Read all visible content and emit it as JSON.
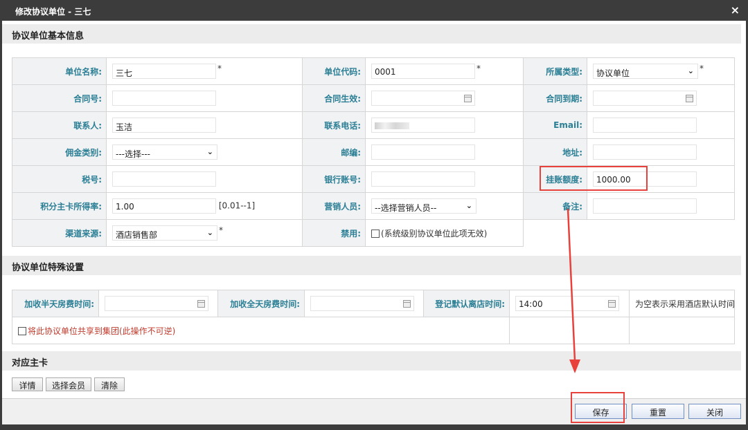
{
  "window": {
    "title": "修改协议单位 - 三七",
    "close_glyph": "×"
  },
  "sections": {
    "basic": "协议单位基本信息",
    "special": "协议单位特殊设置",
    "card": "对应主卡"
  },
  "basic": {
    "unit_name": {
      "label": "单位名称:",
      "value": "三七"
    },
    "unit_code": {
      "label": "单位代码:",
      "value": "0001"
    },
    "type": {
      "label": "所属类型:",
      "value": "协议单位"
    },
    "contract_no": {
      "label": "合同号:",
      "value": ""
    },
    "contract_start": {
      "label": "合同生效:",
      "value": ""
    },
    "contract_end": {
      "label": "合同到期:",
      "value": ""
    },
    "contact": {
      "label": "联系人:",
      "value": "玉洁"
    },
    "phone": {
      "label": "联系电话:",
      "value": ""
    },
    "email": {
      "label": "Email:",
      "value": ""
    },
    "commission": {
      "label": "佣金类别:",
      "value": "---选择---"
    },
    "postcode": {
      "label": "邮编:",
      "value": ""
    },
    "address": {
      "label": "地址:",
      "value": ""
    },
    "tax_no": {
      "label": "税号:",
      "value": ""
    },
    "bank_account": {
      "label": "银行账号:",
      "value": ""
    },
    "credit_limit": {
      "label": "挂账额度:",
      "value": "1000.00"
    },
    "points_rate": {
      "label": "积分主卡所得率:",
      "value": "1.00",
      "hint": "[0.01--1]"
    },
    "sales": {
      "label": "营销人员:",
      "value": "--选择营销人员--"
    },
    "remark": {
      "label": "备注:",
      "value": ""
    },
    "channel": {
      "label": "渠道来源:",
      "value": "酒店销售部"
    },
    "disabled": {
      "label": "禁用:",
      "text": "(系统级别协议单位此项无效)"
    },
    "required_mark": "*"
  },
  "special": {
    "half_day": {
      "label": "加收半天房费时间:",
      "value": ""
    },
    "full_day": {
      "label": "加收全天房费时间:",
      "value": ""
    },
    "checkout": {
      "label": "登记默认离店时间:",
      "value": "14:00"
    },
    "note": "为空表示采用酒店默认时间",
    "share_text": "将此协议单位共享到集团(此操作不可逆)"
  },
  "card_buttons": {
    "detail": "详情",
    "select_member": "选择会员",
    "clear": "清除"
  },
  "footer": {
    "save": "保存",
    "reset": "重置",
    "close": "关闭"
  },
  "colors": {
    "label": "#2b7f95",
    "titlebar": "#3c3c3c",
    "highlight": "#e8403a"
  }
}
